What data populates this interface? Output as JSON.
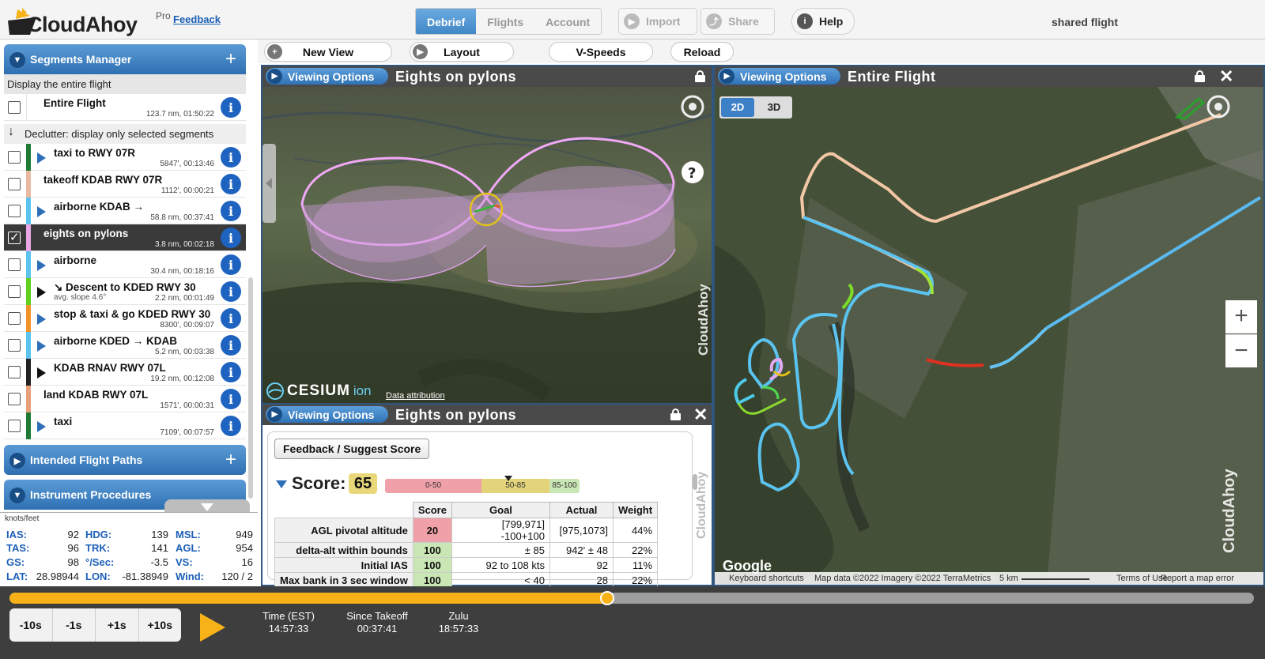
{
  "header": {
    "logo_text": "CloudAhoy",
    "pro_label": "Pro",
    "feedback_label": "Feedback",
    "tabs": [
      {
        "label": "Debrief",
        "active": true
      },
      {
        "label": "Flights",
        "active": false
      },
      {
        "label": "Account",
        "active": false
      }
    ],
    "import_label": "Import",
    "share_label": "Share",
    "help_label": "Help",
    "shared_flight_label": "shared flight"
  },
  "toolbar": {
    "new_view_label": "New View",
    "layout_label": "Layout",
    "vspeeds_label": "V-Speeds",
    "reload_label": "Reload"
  },
  "segments_manager": {
    "title": "Segments Manager",
    "display_entire_label": "Display the entire flight",
    "entire_flight": {
      "name": "Entire Flight",
      "meta": "123.7 nm, 01:50:22"
    },
    "declutter_label": "Declutter: display only selected segments",
    "segments": [
      {
        "name": "taxi to RWY 07R",
        "meta": "5847', 00:13:46",
        "color": "#1f7a36",
        "tri": "blue",
        "checked": false
      },
      {
        "name": "takeoff KDAB RWY 07R",
        "meta": "1112', 00:00:21",
        "color": "#e8b9a0",
        "tri": "none",
        "checked": false
      },
      {
        "name": "airborne KDAB →",
        "meta": "58.8 nm, 00:37:41",
        "color": "#5cc3ef",
        "tri": "blue",
        "checked": false
      },
      {
        "name": "eights on pylons",
        "meta": "3.8 nm, 00:02:18",
        "color": "#e9a7e6",
        "tri": "none",
        "checked": true
      },
      {
        "name": "airborne",
        "meta": "30.4 nm, 00:18:16",
        "color": "#5cc3ef",
        "tri": "blue",
        "checked": false
      },
      {
        "name": "↘ Descent to KDED RWY 30",
        "sub": "avg. slope 4.6°",
        "meta": "2.2 nm, 00:01:49",
        "color": "#5fd11d",
        "tri": "black",
        "checked": false
      },
      {
        "name": "stop & taxi & go KDED RWY 30",
        "meta": "8300', 00:09:07",
        "color": "#f2922a",
        "tri": "blue",
        "checked": false
      },
      {
        "name": "airborne KDED → KDAB",
        "meta": "5.2 nm, 00:03:38",
        "color": "#5cc3ef",
        "tri": "blue",
        "checked": false
      },
      {
        "name": "KDAB RNAV RWY 07L",
        "meta": "19.2 nm, 00:12:08",
        "color": "#222222",
        "tri": "black",
        "checked": false
      },
      {
        "name": "land KDAB RWY 07L",
        "meta": "1571', 00:00:31",
        "color": "#e8a07a",
        "tri": "none",
        "checked": false
      },
      {
        "name": "taxi",
        "meta": "7109', 00:07:57",
        "color": "#1f7a36",
        "tri": "blue",
        "checked": false
      }
    ]
  },
  "intended_paths_title": "Intended Flight Paths",
  "instrument_procedures_title": "Instrument Procedures",
  "instruments": {
    "unit": "knots/feet",
    "ias": {
      "label": "IAS:",
      "value": "92"
    },
    "tas": {
      "label": "TAS:",
      "value": "96"
    },
    "gs": {
      "label": "GS:",
      "value": "98"
    },
    "lat": {
      "label": "LAT:",
      "value": "28.98944"
    },
    "hdg": {
      "label": "HDG:",
      "value": "139"
    },
    "trk": {
      "label": "TRK:",
      "value": "141"
    },
    "rot": {
      "label": "°/Sec:",
      "value": "-3.5"
    },
    "lon": {
      "label": "LON:",
      "value": "-81.38949"
    },
    "msl": {
      "label": "MSL:",
      "value": "949"
    },
    "agl": {
      "label": "AGL:",
      "value": "954"
    },
    "vs": {
      "label": "VS:",
      "value": "16"
    },
    "wind": {
      "label": "Wind:",
      "value": "120 / 2"
    }
  },
  "view3d": {
    "viewing_options_label": "Viewing Options",
    "title": "Eights on pylons",
    "brand": "CloudAhoy",
    "cesium_label": "CESIUM",
    "ion_label": "ion",
    "attribution_label": "Data attribution",
    "help_q": "?"
  },
  "viewscore": {
    "viewing_options_label": "Viewing Options",
    "title": "Eights on pylons",
    "feedback_button": "Feedback / Suggest Score",
    "score_label": "Score:",
    "score_value": "65",
    "range_labels": [
      "0-50",
      "50-85",
      "85-100"
    ],
    "colors": {
      "bad": "#f0a0a8",
      "mid": "#e3d37a",
      "good": "#c9e6b5"
    },
    "table": {
      "headers": [
        "Score",
        "Goal",
        "Actual",
        "Weight"
      ],
      "rows": [
        {
          "label": "AGL pivotal altitude",
          "score": "20",
          "goal": "[799,971] -100+100",
          "actual": "[975,1073]",
          "weight": "44%",
          "bad": true
        },
        {
          "label": "delta-alt within bounds",
          "score": "100",
          "goal": "± 85",
          "actual": "942' ± 48",
          "weight": "22%",
          "bad": false
        },
        {
          "label": "Initial IAS",
          "score": "100",
          "goal": "92 to 108 kts",
          "actual": "92",
          "weight": "11%",
          "bad": false
        },
        {
          "label": "Max bank in 3 sec window",
          "score": "100",
          "goal": "< 40",
          "actual": "28",
          "weight": "22%",
          "bad": false
        }
      ]
    }
  },
  "viewmap": {
    "viewing_options_label": "Viewing Options",
    "title": "Entire Flight",
    "btn_2d": "2D",
    "btn_3d": "3D",
    "zoom_in": "+",
    "zoom_out": "−",
    "brand": "CloudAhoy",
    "google_label": "Google",
    "footer": {
      "shortcuts": "Keyboard shortcuts",
      "mapdata": "Map data ©2022 Imagery ©2022 TerraMetrics",
      "scale": "5 km",
      "terms": "Terms of Use",
      "report": "Report a map error"
    }
  },
  "timeline": {
    "progress": 0.48,
    "steps": [
      "-10s",
      "-1s",
      "+1s",
      "+10s"
    ],
    "time_est_label": "Time (EST)",
    "time_est": "14:57:33",
    "since_takeoff_label": "Since Takeoff",
    "since_takeoff": "00:37:41",
    "zulu_label": "Zulu",
    "zulu": "18:57:33"
  }
}
